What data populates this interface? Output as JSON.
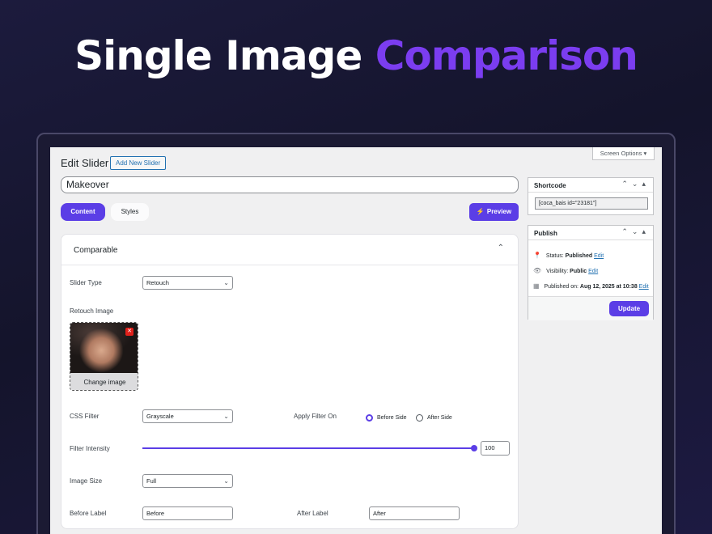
{
  "hero": {
    "title_main": "Single Image",
    "title_accent": "Comparison"
  },
  "header": {
    "title": "Edit Slider",
    "add_new_label": "Add New Slider",
    "screen_options_label": "Screen Options ▾"
  },
  "slider_title": "Makeover",
  "tabs": [
    {
      "label": "Content",
      "active": true
    },
    {
      "label": "Styles",
      "active": false
    }
  ],
  "preview_label": "Preview",
  "panel": {
    "title": "Comparable",
    "slider_type": {
      "label": "Slider Type",
      "value": "Retouch"
    },
    "retouch_image": {
      "label": "Retouch Image",
      "change_label": "Change image"
    },
    "css_filter": {
      "label": "CSS Filter",
      "value": "Grayscale"
    },
    "apply_filter": {
      "label": "Apply Filter On",
      "options": [
        {
          "label": "Before Side",
          "checked": true
        },
        {
          "label": "After Side",
          "checked": false
        }
      ]
    },
    "filter_intensity": {
      "label": "Filter Intensity",
      "value": "100",
      "fraction": 1.0
    },
    "image_size": {
      "label": "Image Size",
      "value": "Full"
    },
    "before_label": {
      "label": "Before Label",
      "value": "Before"
    },
    "after_label": {
      "label": "After Label",
      "value": "After"
    }
  },
  "shortcode_box": {
    "title": "Shortcode",
    "value": "[coca_bais id=\"23181\"]"
  },
  "publish_box": {
    "title": "Publish",
    "status_label": "Status:",
    "status_value": "Published",
    "status_edit": "Edit",
    "visibility_label": "Visibility:",
    "visibility_value": "Public",
    "visibility_edit": "Edit",
    "published_label": "Published on:",
    "published_value": "Aug 12, 2025 at 10:38",
    "published_edit": "Edit",
    "update_label": "Update"
  },
  "colors": {
    "accent": "#5b3ee6",
    "hero_accent": "#7b3df0",
    "link": "#2271b1"
  }
}
